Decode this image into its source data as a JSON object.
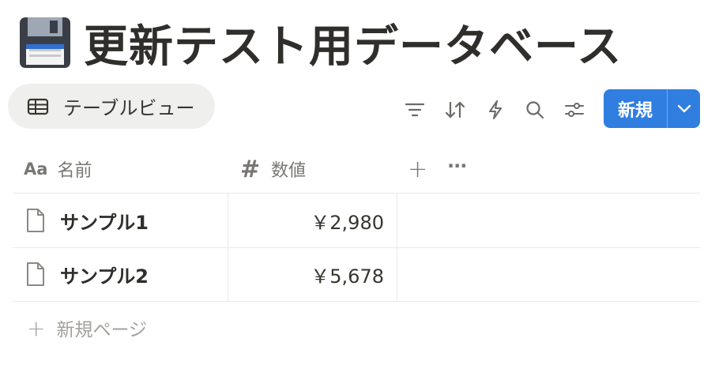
{
  "page": {
    "icon": "floppy-disk-icon",
    "title": "更新テスト用データベース"
  },
  "view": {
    "tab_label": "テーブルビュー",
    "tab_icon": "table-icon"
  },
  "toolbar": {
    "icons": [
      "filter-icon",
      "sort-icon",
      "automation-icon",
      "search-icon",
      "settings-icon"
    ],
    "new_label": "新規",
    "accent": "#2f7ee0"
  },
  "table": {
    "columns": [
      {
        "label": "名前",
        "icon": "text-property-icon",
        "icon_text": "Aa"
      },
      {
        "label": "数値",
        "icon": "number-property-icon",
        "icon_text": "#"
      }
    ],
    "add_column_label": "+",
    "more_label": "···",
    "rows": [
      {
        "name": "サンプル1",
        "value": "￥2,980"
      },
      {
        "name": "サンプル2",
        "value": "￥5,678"
      }
    ],
    "add_page_label": "新規ページ"
  }
}
